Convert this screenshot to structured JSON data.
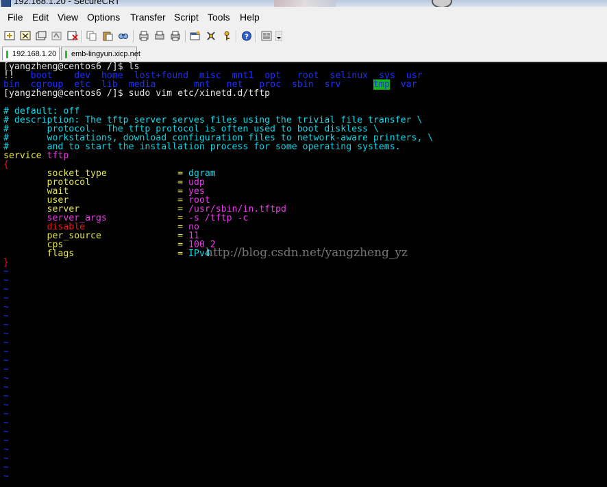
{
  "window": {
    "title": "192.168.1.20 - SecureCRT"
  },
  "menu": [
    "File",
    "Edit",
    "View",
    "Options",
    "Transfer",
    "Script",
    "Tools",
    "Help"
  ],
  "toolbar": {
    "icons": [
      "connect-icon",
      "quick-connect-icon",
      "connect-tab-icon",
      "reconnect-icon",
      "disconnect-icon",
      "copy-icon",
      "paste-icon",
      "find-icon",
      "print-setup-icon",
      "print-icon",
      "print-selection-icon",
      "session-options-icon",
      "global-options-icon",
      "keymap-icon",
      "help-icon",
      "tile-icon",
      "dropdown-arrow-icon"
    ]
  },
  "tabs": [
    {
      "label": "192.168.1.20",
      "status_color": "#2bbf2b"
    },
    {
      "label": "emb-lingyun.xicp.net",
      "status_color": "#2bbf2b"
    }
  ],
  "terminal": {
    "prompt1": "[yangzheng@centos6 /]$ ls",
    "ls_row1": [
      "!!",
      "boot",
      "dev",
      "home",
      "lost+found",
      "misc",
      "mnt1",
      "opt",
      "root",
      "selinux",
      "sys",
      "usr"
    ],
    "ls_row2": [
      "bin",
      "cgroup",
      "etc",
      "lib",
      "media",
      "mnt",
      "net",
      "proc",
      "sbin",
      "srv",
      "tmp",
      "var"
    ],
    "prompt2": "[yangzheng@centos6 /]$ sudo vim etc/xinetd.d/tftp",
    "comments": [
      "# default: off",
      "# description: The tftp server serves files using the trivial file transfer \\",
      "#       protocol.  The tftp protocol is often used to boot diskless \\",
      "#       workstations, download configuration files to network-aware printers, \\",
      "#       and to start the installation process for some operating systems."
    ],
    "service_keyword": "service",
    "service_name": "tftp",
    "open_brace": "{",
    "close_brace": "}",
    "equals": "=",
    "config": [
      {
        "key": "socket_type",
        "value": "dgram"
      },
      {
        "key": "protocol",
        "value": "udp"
      },
      {
        "key": "wait",
        "value": "yes"
      },
      {
        "key": "user",
        "value": "root"
      },
      {
        "key": "server",
        "value": "/usr/sbin/in.tftpd"
      },
      {
        "key": "server_args",
        "value": "-s /tftp -c"
      },
      {
        "key": "disable",
        "value": "no"
      },
      {
        "key": "per_source",
        "value": "11"
      },
      {
        "key": "cps",
        "value": "100 2"
      },
      {
        "key": "flags",
        "value": "IPv4"
      }
    ],
    "tilde": "~"
  },
  "watermark": "http://blog.csdn.net/yangzheng_yz"
}
